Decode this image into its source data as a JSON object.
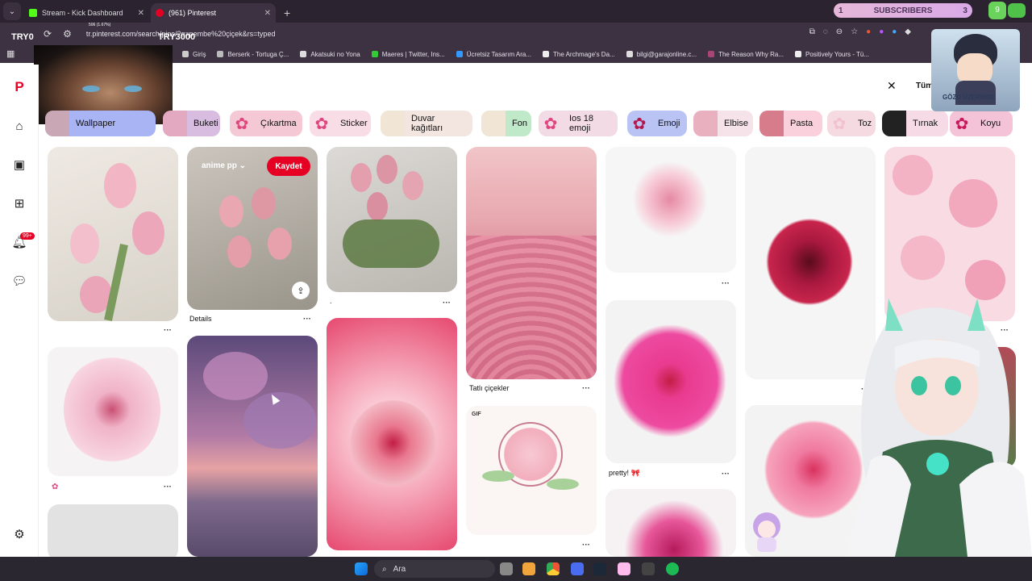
{
  "browser": {
    "tabs": [
      {
        "title": "Stream - Kick Dashboard",
        "active": false,
        "favicon_color": "#53fc18"
      },
      {
        "title": "(961) Pinterest",
        "active": true,
        "favicon_color": "#e60023"
      }
    ],
    "new_tab_symbol": "+",
    "url": "tr.pinterest.com/search/pins/?q=pembe%20çiçek&rs=typed",
    "bookmarks": [
      "Giriş",
      "Berserk - Tortuga Ç...",
      "Akatsuki no Yona",
      "Maeres | Twitter, Ins...",
      "Ücretsiz Tasarım Ara...",
      "The Archmage's Da...",
      "bilgi@garajonline.c...",
      "The Reason Why Ra...",
      "Positively Yours - Tü..."
    ]
  },
  "overlay": {
    "try_left": "TRY0",
    "try_right": "TRY3000",
    "subscribers_label": "SUBSCRIBERS",
    "subscribers_left": "1",
    "subscribers_right": "3",
    "ext_badge": "9",
    "avatar_caption": "GÖZÜ ÜZERİNDE",
    "donation_progress": "506 (1.67%)"
  },
  "sidebar": {
    "notification_badge": "99+"
  },
  "search": {
    "close_symbol": "✕",
    "filter_label": "Tüm"
  },
  "chips": [
    {
      "label": "Wallpaper",
      "bg": "#a9b4f5",
      "thumb": "#c9a7b5"
    },
    {
      "label": "Buketi",
      "bg": "#d9bde0",
      "thumb": "#e2a9c0"
    },
    {
      "label": "Çıkartma",
      "bg": "#f4c9d5",
      "thumb": "#e0457e"
    },
    {
      "label": "Sticker",
      "bg": "#f9dde6",
      "thumb": "#e0457e"
    },
    {
      "label": "Duvar kağıtları",
      "bg": "#f3e6e0",
      "thumb": "#f1e6d6"
    },
    {
      "label": "Fon",
      "bg": "#bfe9c9",
      "thumb": "#f1e6d6"
    },
    {
      "label": "Ios 18 emoji",
      "bg": "#f2dbe4",
      "thumb": "#e0457e"
    },
    {
      "label": "Emoji",
      "bg": "#b9c4f5",
      "thumb": "#b3184c"
    },
    {
      "label": "Elbise",
      "bg": "#f6e3ea",
      "thumb": "#e9b0c0"
    },
    {
      "label": "Pasta",
      "bg": "#f9d0dc",
      "thumb": "#d77c8b"
    },
    {
      "label": "Toz",
      "bg": "#f6dae2",
      "thumb": "#f2c1cf"
    },
    {
      "label": "Tırnak",
      "bg": "#f6dbe6",
      "thumb": "#222222"
    },
    {
      "label": "Koyu",
      "bg": "#f4c3d7",
      "thumb": "#c8175c"
    }
  ],
  "pins": {
    "board_select": "anime pp",
    "save_button": "Kaydet",
    "captions": {
      "details": "Details",
      "dot": ".",
      "tatli": "Tatlı çiçekler",
      "pretty": "pretty! 🎀"
    },
    "gif_label": "GIF",
    "more_symbol": "···"
  },
  "taskbar": {
    "search_label": "Ara"
  }
}
